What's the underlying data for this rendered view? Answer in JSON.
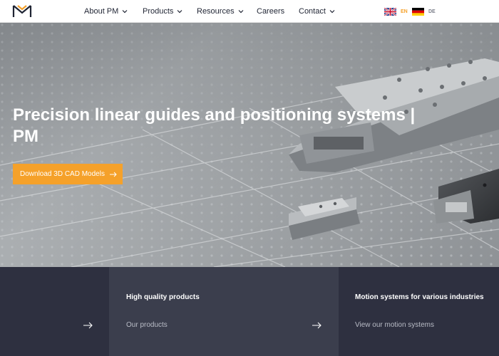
{
  "colors": {
    "accent": "#f5a12a",
    "panel_dark": "#2e3040",
    "panel_mid": "#3b3e4d"
  },
  "header": {
    "logo_icon": "pm-logo-icon",
    "nav": [
      {
        "label": "About PM",
        "has_dropdown": true
      },
      {
        "label": "Products",
        "has_dropdown": true
      },
      {
        "label": "Resources",
        "has_dropdown": true
      },
      {
        "label": "Careers",
        "has_dropdown": false
      },
      {
        "label": "Contact",
        "has_dropdown": true
      }
    ],
    "languages": [
      {
        "code": "EN",
        "flag": "uk-flag-icon",
        "color": "#f5a12a"
      },
      {
        "code": "DE",
        "flag": "germany-flag-icon",
        "color": "#7b7f8a"
      }
    ]
  },
  "hero": {
    "title": "Precision linear guides and positioning systems | PM",
    "cta_label": "Download 3D CAD Models",
    "cta_icon": "arrow-right-icon"
  },
  "panels": [
    {
      "title": "",
      "link": "",
      "icon": "arrow-right-icon"
    },
    {
      "title": "High quality products",
      "link": "Our products",
      "icon": "arrow-right-icon"
    },
    {
      "title": "Motion systems for various industries",
      "link": "View our motion systems"
    }
  ]
}
